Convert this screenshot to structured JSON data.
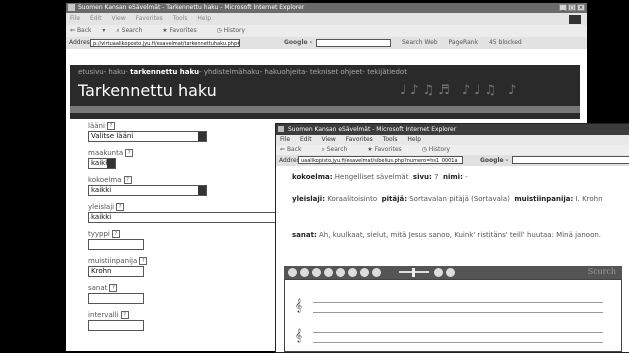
{
  "browser": {
    "title": "Suomen Kansan eSävelmät - Tarkennettu haku - Microsoft Internet Explorer",
    "menu": [
      "File",
      "Edit",
      "View",
      "Favorites",
      "Tools",
      "Help"
    ],
    "toolbar": [
      "Back",
      "Search",
      "Favorites",
      "History"
    ],
    "address_label": "Address",
    "address": "p://virtuaalikoposto.jyu.fi/esavelmat/tarkennettuhaku.php#skt",
    "google_label": "Google -",
    "extras": [
      "Search Web",
      "PageRank",
      "45 blocked"
    ]
  },
  "page": {
    "nav": {
      "pre": "etusivu- haku-",
      "current": "tarkennettu haku",
      "post": "- yhdistelmähaku- hakuohjeita- tekniset ohjeet- tekijätiedot"
    },
    "title": "Tarkennettu haku",
    "header_notes": "♩♪♫♬ ♪♩♫ ♪"
  },
  "form": {
    "laani_label": "lääni",
    "laani_value": "Valitse lääni",
    "maakunta_label": "maakunta",
    "maakunta_value": "kaikki",
    "kokoelma_label": "kokoelma",
    "kokoelma_value": "kaikki",
    "yleislaji_label": "yleislaji",
    "yleislaji_value": "kaikki",
    "tyyppi_label": "tyyppi",
    "tyyppi_value": "",
    "muistiinpanija_label": "muistiinpanija",
    "muistiinpanija_value": "Krohn",
    "sanat_label": "sanat",
    "sanat_value": "",
    "intervalli_label": "intervalli",
    "intervalli_value": ""
  },
  "popup": {
    "title": "Suomen Kansan eSävelmät - Microsoft Internet Explorer",
    "menu": [
      "File",
      "Edit",
      "View",
      "Favorites",
      "Tools",
      "Help"
    ],
    "toolbar": [
      "Back",
      "Search",
      "Favorites",
      "History"
    ],
    "address_label": "Address",
    "address": "uaalikopisto.jyu.fi/esavelmat/sibelius.php?numero=hs1_0001a",
    "google_label": "Google -",
    "kokoelma_label": "kokoelma:",
    "kokoelma_value": "Hengelliset sävelmät",
    "sivu_label": "sivu:",
    "sivu_value": "7",
    "nimi_label": "nimi:",
    "nimi_value": "-",
    "yleislaji_label": "yleislaji:",
    "yleislaji_value": "Koraalitoisinto",
    "pitaja_label": "pitäjä:",
    "pitaja_value": "Sortavalan pitäjä (Sortavala)",
    "muistiinpanija_label": "muistiinpanija:",
    "muistiinpanija_value": "I. Krohn",
    "sanat_label": "sanat:",
    "sanat_value": "Ah, kuulkaat, sielut, mitä Jesus sanoo, Kuink' ristitäns' teill' huutaa: Minä janoon.",
    "player_brand": "Scorch",
    "clef": "𝄞"
  }
}
